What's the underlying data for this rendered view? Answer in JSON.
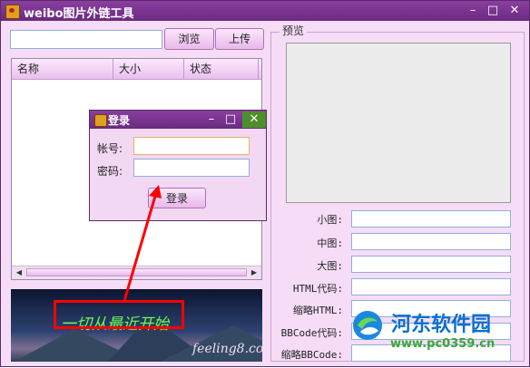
{
  "window": {
    "title": "weibo图片外链工具"
  },
  "toolbar": {
    "browse_label": "浏览",
    "upload_label": "上传",
    "path_value": ""
  },
  "file_list": {
    "columns": [
      "名称",
      "大小",
      "状态"
    ],
    "rows": []
  },
  "preview": {
    "group_title": "预览"
  },
  "links": [
    {
      "label": "小图:",
      "value": ""
    },
    {
      "label": "中图:",
      "value": ""
    },
    {
      "label": "大图:",
      "value": ""
    },
    {
      "label": "HTML代码:",
      "value": ""
    },
    {
      "label": "缩略HTML:",
      "value": ""
    },
    {
      "label": "BBCode代码:",
      "value": ""
    },
    {
      "label": "缩略BBCode:",
      "value": ""
    }
  ],
  "login_dialog": {
    "title": "登录",
    "account_label": "帐号:",
    "password_label": "密码:",
    "login_button": "登录",
    "account_value": "",
    "password_value": ""
  },
  "banner": {
    "handwriting": "一切从最近开始",
    "signature": "feeling8.com"
  },
  "watermark": {
    "title": "河东软件园",
    "url": "www.pc0359.cn"
  },
  "colors": {
    "titlebar": "#7a3592",
    "accent": "#ff0000",
    "dialog_close": "#4f8e2c"
  }
}
